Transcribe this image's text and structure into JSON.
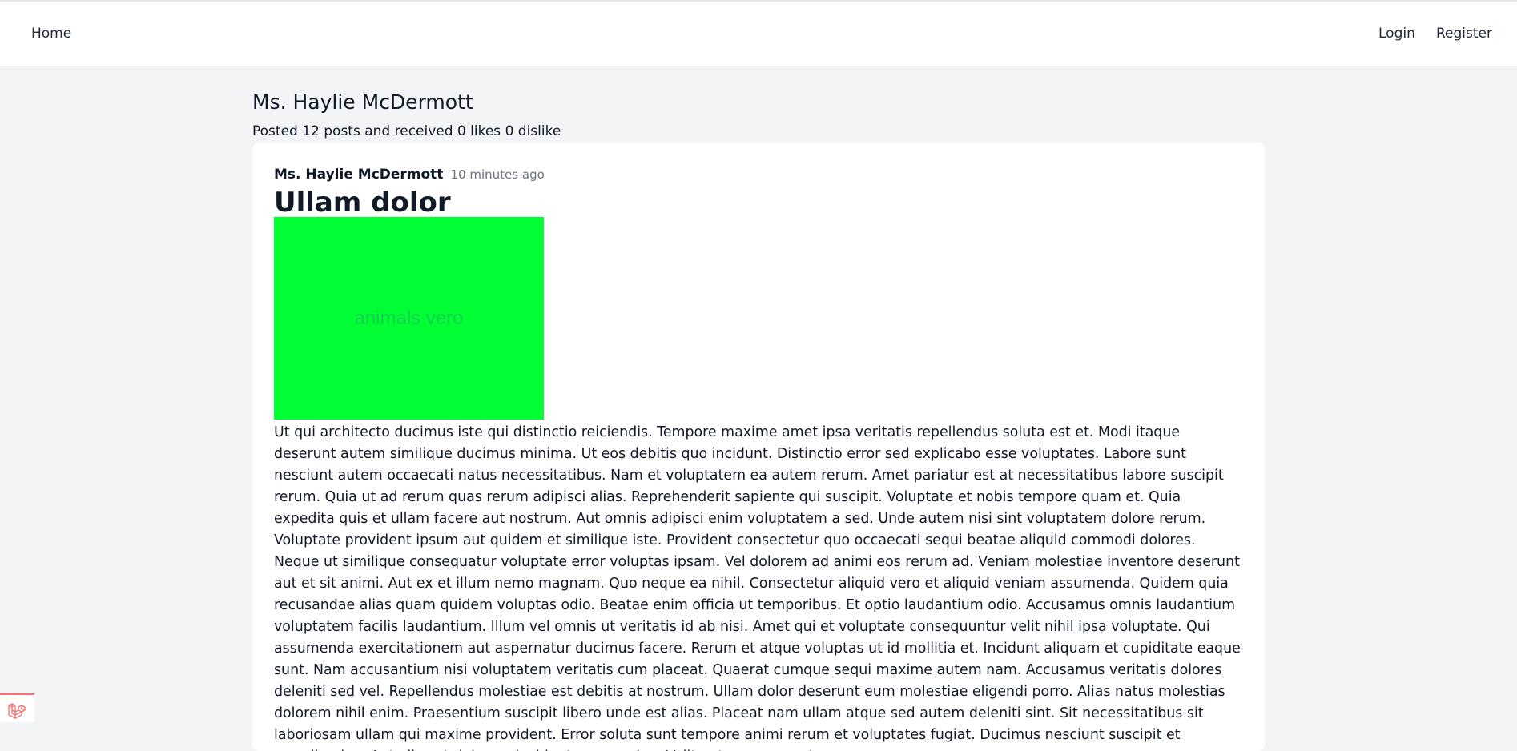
{
  "nav": {
    "home": "Home",
    "login": "Login",
    "register": "Register"
  },
  "profile": {
    "name": "Ms. Haylie McDermott",
    "stats": "Posted 12 posts and received 0 likes 0 dislike"
  },
  "post": {
    "author": "Ms. Haylie McDermott",
    "time": "10 minutes ago",
    "title": "Ullam dolor",
    "image": {
      "text": "animals vero",
      "background": "#00ff33"
    },
    "body": "Ut qui architecto ducimus iste qui distinctio reiciendis. Tempore maxime amet ipsa veritatis repellendus soluta est et. Modi itaque deserunt autem similique ducimus minima. Ut eos debitis quo incidunt. Distinctio error sed explicabo esse voluptates. Labore sunt nesciunt autem occaecati natus necessitatibus. Nam et voluptatem ea autem rerum. Amet pariatur est at necessitatibus labore suscipit rerum. Quia ut ad rerum quas rerum adipisci alias. Reprehenderit sapiente qui suscipit. Voluptate et nobis tempore quam et. Quia expedita quis et ullam facere aut nostrum. Aut omnis adipisci enim voluptatem a sed. Unde autem nisi sint voluptatem dolore rerum. Voluptate provident ipsum aut quidem et similique iste. Provident consectetur quo occaecati sequi beatae aliquid commodi dolores. Neque ut similique consequatur voluptate error voluptas ipsam. Vel dolorem ad animi eos rerum ad. Veniam molestiae inventore deserunt aut et sit animi. Aut ex et illum nemo magnam. Quo neque ea nihil. Consectetur aliquid vero et aliquid veniam assumenda. Quidem quia recusandae alias quam quidem voluptas odio. Beatae enim officia ut temporibus. Et optio laudantium odio. Accusamus omnis laudantium voluptatem facilis laudantium. Illum vel omnis ut veritatis id ab nisi. Amet qui et voluptate consequuntur velit nihil ipsa voluptate. Qui assumenda exercitationem aut aspernatur ducimus facere. Rerum et atque voluptas ut id mollitia et. Incidunt aliquam et cupiditate eaque sunt. Nam accusantium nisi voluptatem veritatis cum placeat. Quaerat cumque sequi maxime autem nam. Accusamus veritatis dolores deleniti sed vel. Repellendus molestiae est debitis at nostrum. Ullam dolor deserunt eum molestiae eligendi porro. Alias natus molestias dolorem nihil enim. Praesentium suscipit libero unde est alias. Placeat nam ullam atque sed autem deleniti sint. Sit necessitatibus sit laboriosam ullam qui maxime provident. Error soluta sunt tempore animi rerum et voluptates fugiat. Ducimus nesciunt suscipit et repudiandae. Aut alias et dolorem incidunt recusandae. Velit autem earum et"
  },
  "colors": {
    "page_background": "#f3f4f6",
    "card_background": "#ffffff",
    "accent_red": "#f87171"
  },
  "icons": {
    "debug_badge": "laravel-logo-icon"
  }
}
